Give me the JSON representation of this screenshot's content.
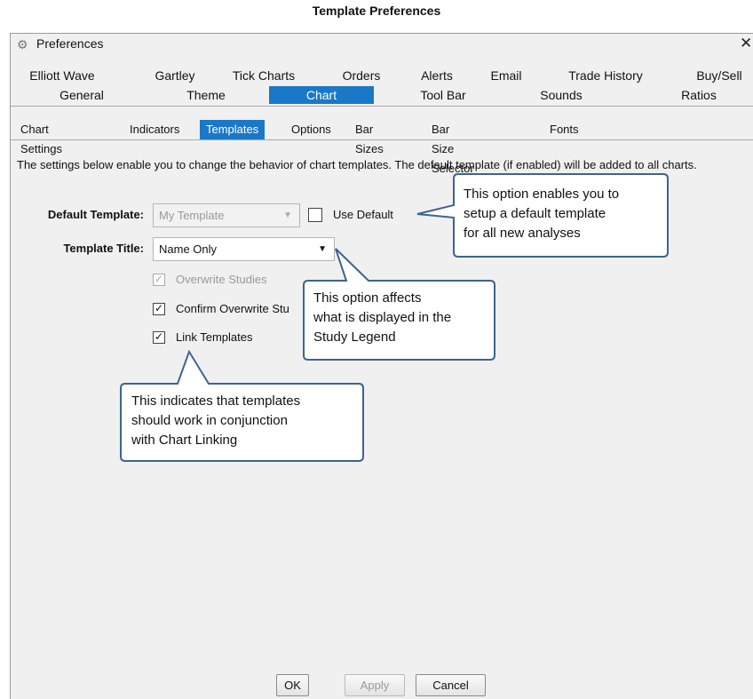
{
  "doc_title": "Template Preferences",
  "window": {
    "title": "Preferences",
    "close": "✕",
    "icon": "gear-icon"
  },
  "tabs_row1": [
    "Elliott Wave",
    "Gartley",
    "Tick Charts",
    "Orders",
    "Alerts",
    "Email",
    "Trade History",
    "Buy/Sell"
  ],
  "tabs_row2": [
    "General",
    "Theme",
    "Chart",
    "Tool Bar",
    "Sounds",
    "Ratios"
  ],
  "subtabs": [
    "Chart Settings",
    "Indicators",
    "Templates",
    "Options",
    "Bar Sizes",
    "Bar Size Selector",
    "Fonts"
  ],
  "description": "The settings below enable you to change the behavior of chart templates. The default template (if enabled) will be added to all charts.",
  "form": {
    "default_template_label": "Default Template:",
    "default_template_value": "My Template",
    "use_default_label": "Use Default",
    "template_title_label": "Template Title:",
    "template_title_value": "Name Only",
    "overwrite_studies_label": "Overwrite Studies",
    "confirm_overwrite_label": "Confirm Overwrite Stu",
    "link_templates_label": "Link Templates",
    "checkmark": "✓"
  },
  "callouts": {
    "use_default": [
      "This option enables you to",
      "setup a default template",
      "for all new analyses"
    ],
    "template_title": [
      "This option affects",
      "what is displayed in the",
      "Study Legend"
    ],
    "link_templates": [
      "This indicates that templates",
      "should work in conjunction",
      "with Chart Linking"
    ]
  },
  "buttons": {
    "ok": "OK",
    "apply": "Apply",
    "cancel": "Cancel"
  },
  "colors": {
    "accent": "#1a78c8",
    "callout_border": "#3e6391",
    "window_bg": "#f0f0f0"
  }
}
